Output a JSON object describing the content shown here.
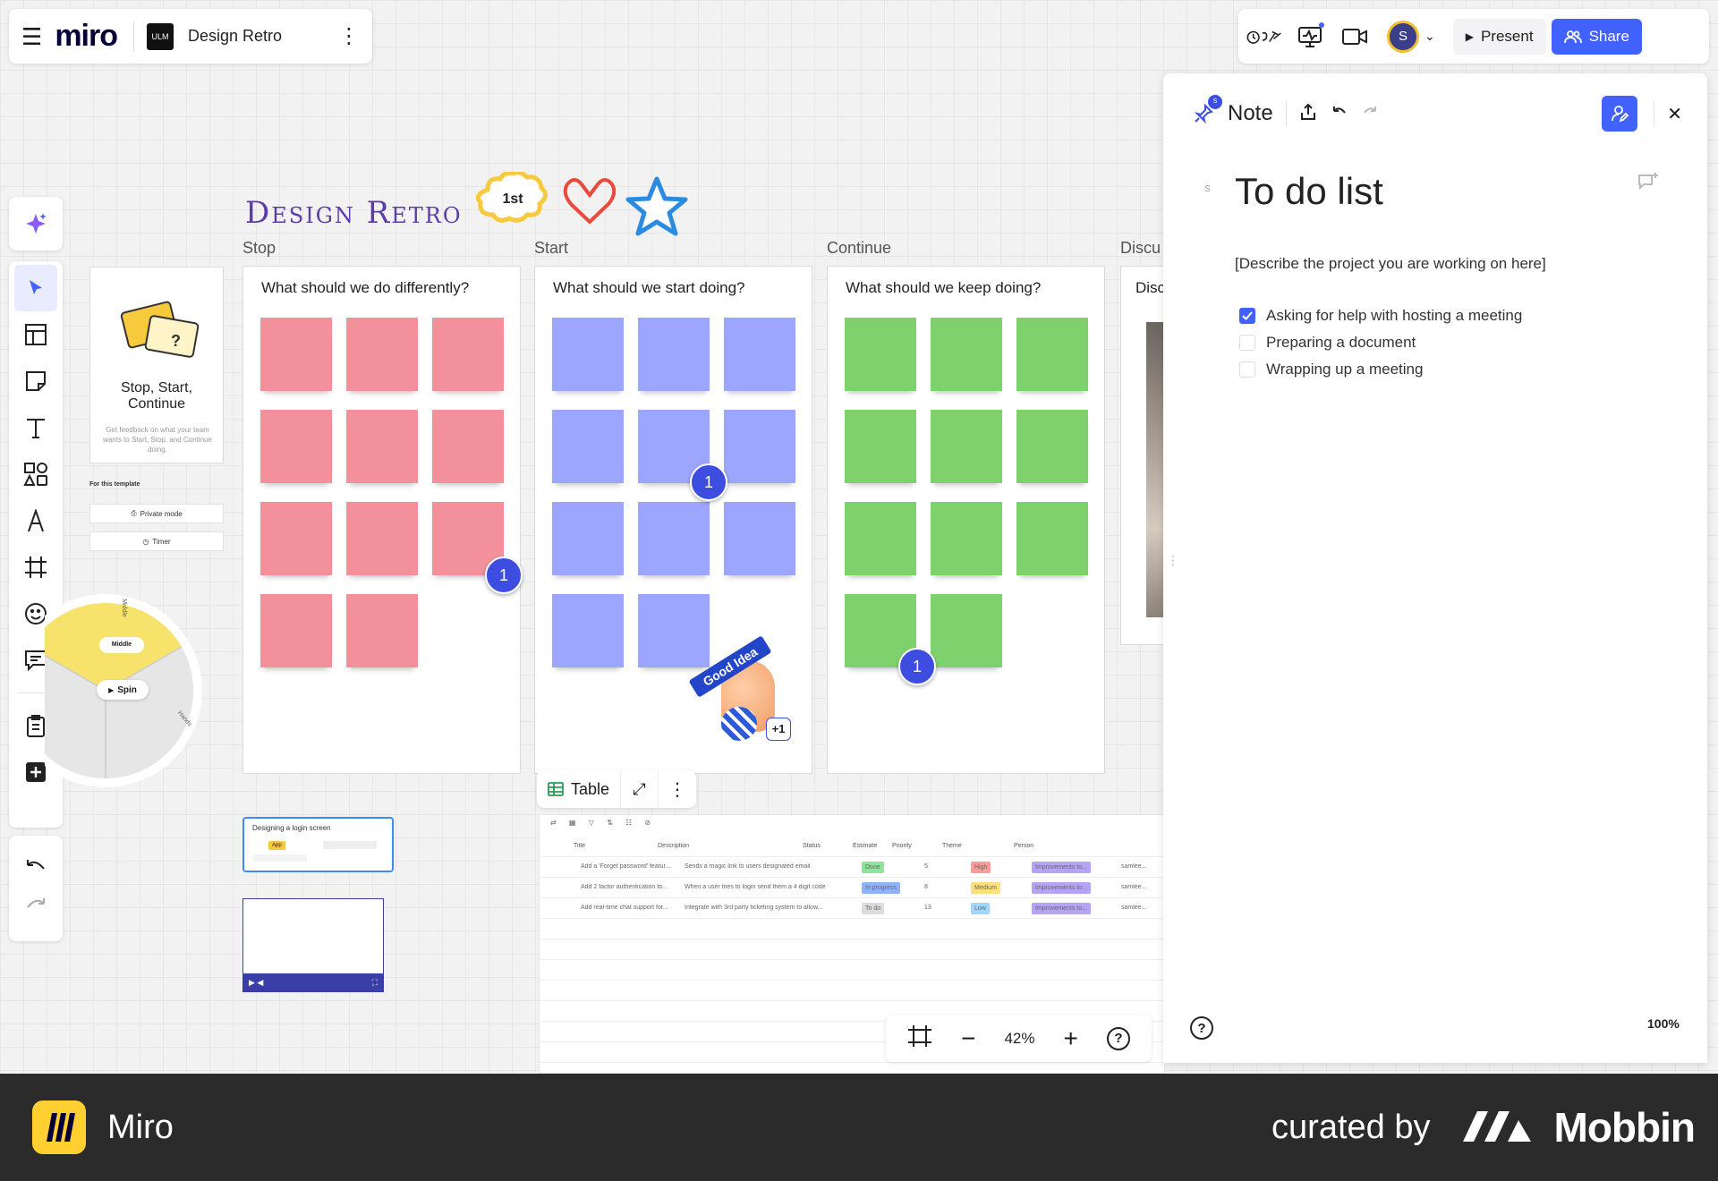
{
  "topbar": {
    "app_logo": "miro",
    "board_badge": "ULM",
    "board_title": "Design Retro",
    "present_label": "Present",
    "share_label": "Share",
    "avatar_initial": "S"
  },
  "board": {
    "retro_title": "Design Retro",
    "sticker_1st": "1st",
    "columns": [
      {
        "label": "Stop",
        "question": "What should we do differently?"
      },
      {
        "label": "Start",
        "question": "What should we start doing?"
      },
      {
        "label": "Continue",
        "question": "What should we keep doing?"
      },
      {
        "label": "Discu",
        "question": "Disc"
      }
    ],
    "badges": [
      "1",
      "1",
      "1"
    ],
    "good_idea_sticker": "Good Idea",
    "plus_one": "+1",
    "colors": {
      "stop": "#f2909c",
      "start": "#9ba6fc",
      "continue": "#7fd16e"
    }
  },
  "info_card": {
    "title": "Stop, Start, Continue",
    "description": "Get feedback on what your team wants to Start, Stop, and Continue doing.",
    "for_template": "For this template",
    "private_mode": "Private mode",
    "timer": "Timer"
  },
  "spinner": {
    "middle": "Middle",
    "spin": "Spin",
    "label_top": "Middle",
    "label_right": "Hands"
  },
  "kanban_card": {
    "title": "Designing a login screen",
    "tag": "App"
  },
  "table": {
    "toolbar_label": "Table",
    "columns": [
      "Title",
      "Description",
      "Status",
      "Estimate",
      "Priority",
      "Theme",
      "Person"
    ],
    "rows": [
      {
        "title": "Add a 'Forget password' featur...",
        "description": "Sends a magic link to users designated email",
        "status": "Done",
        "estimate": "5",
        "priority": "High",
        "theme": "Improvements to...",
        "person": "samlee..."
      },
      {
        "title": "Add 2 factor authentication to...",
        "description": "When a user tries to login send them a 4 digit code v...",
        "status": "In progress",
        "estimate": "8",
        "priority": "Medium",
        "theme": "Improvements to...",
        "person": "samlee..."
      },
      {
        "title": "Add real-time chat support for...",
        "description": "Integrate with 3rd party ticketing system to allow...",
        "status": "To do",
        "estimate": "13",
        "priority": "Low",
        "theme": "Improvements to...",
        "person": "samlee..."
      }
    ]
  },
  "zoom": {
    "value": "42%"
  },
  "note": {
    "label": "Note",
    "small_initial": "S",
    "title": "To do list",
    "description": "[Describe the project you are working on here]",
    "todos": [
      {
        "text": "Asking for help with hosting a meeting",
        "checked": true
      },
      {
        "text": "Preparing a document",
        "checked": false
      },
      {
        "text": "Wrapping up a meeting",
        "checked": false
      }
    ],
    "zoom": "100%"
  },
  "footer": {
    "app_name": "Miro",
    "curated_by": "curated by",
    "brand": "Mobbin"
  }
}
